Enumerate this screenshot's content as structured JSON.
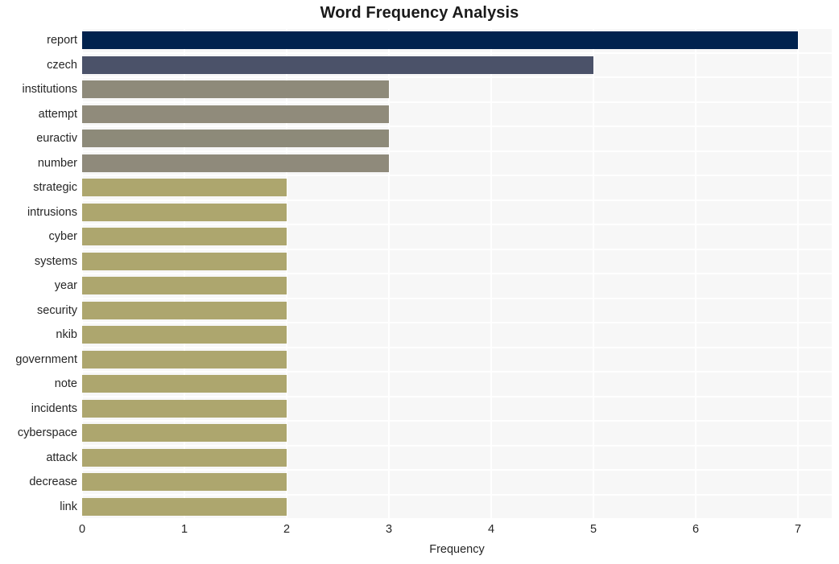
{
  "chart_data": {
    "type": "bar",
    "orientation": "horizontal",
    "title": "Word Frequency Analysis",
    "xlabel": "Frequency",
    "ylabel": "",
    "xlim": [
      0,
      7.33
    ],
    "xticks": [
      0,
      1,
      2,
      3,
      4,
      5,
      6,
      7
    ],
    "grid": true,
    "legend": null,
    "categories": [
      "report",
      "czech",
      "institutions",
      "attempt",
      "euractiv",
      "number",
      "strategic",
      "intrusions",
      "cyber",
      "systems",
      "year",
      "security",
      "nkib",
      "government",
      "note",
      "incidents",
      "cyberspace",
      "attack",
      "decrease",
      "link"
    ],
    "values": [
      7,
      5,
      3,
      3,
      3,
      3,
      2,
      2,
      2,
      2,
      2,
      2,
      2,
      2,
      2,
      2,
      2,
      2,
      2,
      2
    ],
    "bar_colors": [
      "#00224e",
      "#4b5269",
      "#8e8a7a",
      "#908b7b",
      "#8d8a79",
      "#8f8a7b",
      "#ada66e",
      "#ada66e",
      "#ada66e",
      "#ada66e",
      "#ada66e",
      "#ada66e",
      "#ada66e",
      "#ada66e",
      "#ada66e",
      "#ada66e",
      "#ada66e",
      "#ada66e",
      "#ada66e",
      "#ada66e"
    ]
  },
  "style": {
    "plot_background": "#f7f7f7",
    "grid_color": "#ffffff",
    "text_color": "#262626",
    "title_color": "#1a1a1a",
    "page_background": "#ffffff"
  }
}
